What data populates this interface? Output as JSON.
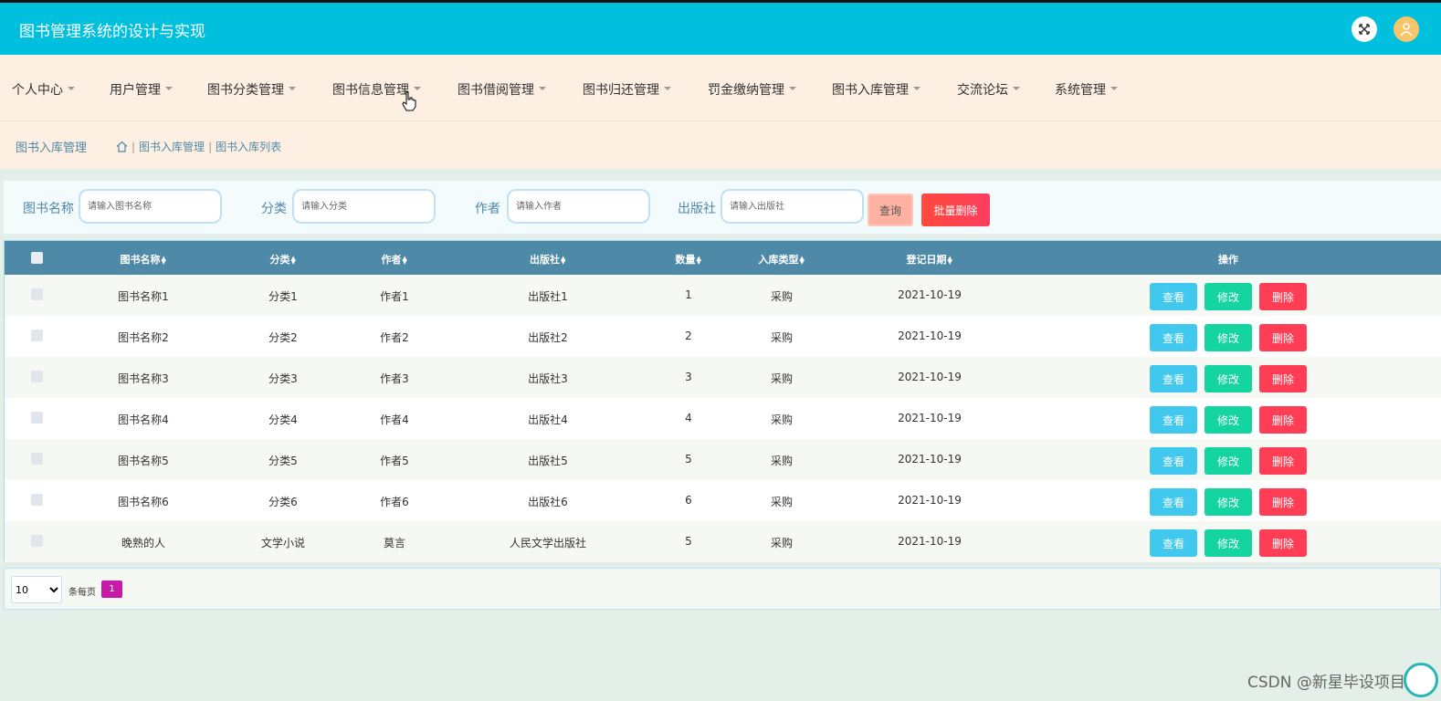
{
  "header": {
    "title": "图书管理系统的设计与实现"
  },
  "nav": {
    "items": [
      {
        "label": "个人中心"
      },
      {
        "label": "用户管理"
      },
      {
        "label": "图书分类管理"
      },
      {
        "label": "图书信息管理"
      },
      {
        "label": "图书借阅管理"
      },
      {
        "label": "图书归还管理"
      },
      {
        "label": "罚金缴纳管理"
      },
      {
        "label": "图书入库管理"
      },
      {
        "label": "交流论坛"
      },
      {
        "label": "系统管理"
      }
    ]
  },
  "breadcrumb": {
    "title": "图书入库管理",
    "path": [
      "图书入库管理",
      "图书入库列表"
    ]
  },
  "search": {
    "fields": [
      {
        "label": "图书名称",
        "placeholder": "请输入图书名称"
      },
      {
        "label": "分类",
        "placeholder": "请输入分类"
      },
      {
        "label": "作者",
        "placeholder": "请输入作者"
      },
      {
        "label": "出版社",
        "placeholder": "请输入出版社"
      }
    ],
    "query_label": "查询",
    "bulk_delete_label": "批量删除"
  },
  "table": {
    "headers": [
      "图书名称",
      "分类",
      "作者",
      "出版社",
      "数量",
      "入库类型",
      "登记日期",
      "操作"
    ],
    "rows": [
      {
        "name": "图书名称1",
        "category": "分类1",
        "author": "作者1",
        "publisher": "出版社1",
        "qty": "1",
        "type": "采购",
        "date": "2021-10-19"
      },
      {
        "name": "图书名称2",
        "category": "分类2",
        "author": "作者2",
        "publisher": "出版社2",
        "qty": "2",
        "type": "采购",
        "date": "2021-10-19"
      },
      {
        "name": "图书名称3",
        "category": "分类3",
        "author": "作者3",
        "publisher": "出版社3",
        "qty": "3",
        "type": "采购",
        "date": "2021-10-19"
      },
      {
        "name": "图书名称4",
        "category": "分类4",
        "author": "作者4",
        "publisher": "出版社4",
        "qty": "4",
        "type": "采购",
        "date": "2021-10-19"
      },
      {
        "name": "图书名称5",
        "category": "分类5",
        "author": "作者5",
        "publisher": "出版社5",
        "qty": "5",
        "type": "采购",
        "date": "2021-10-19"
      },
      {
        "name": "图书名称6",
        "category": "分类6",
        "author": "作者6",
        "publisher": "出版社6",
        "qty": "6",
        "type": "采购",
        "date": "2021-10-19"
      },
      {
        "name": "晚熟的人",
        "category": "文学小说",
        "author": "莫言",
        "publisher": "人民文学出版社",
        "qty": "5",
        "type": "采购",
        "date": "2021-10-19"
      }
    ],
    "actions": {
      "view": "查看",
      "edit": "修改",
      "delete": "删除"
    }
  },
  "pagination": {
    "page_size": "10",
    "per_page_label": "条每页",
    "current_page": "1"
  },
  "watermark": "CSDN @新星毕设项目",
  "colors": {
    "topbar": "#00c0de",
    "menubar": "#fdefe1",
    "table_header": "#4f89a8",
    "view_button": "#41c8ee",
    "edit_button": "#14d59f",
    "delete_button": "#ff3e55",
    "page_active": "#c71aa6"
  }
}
